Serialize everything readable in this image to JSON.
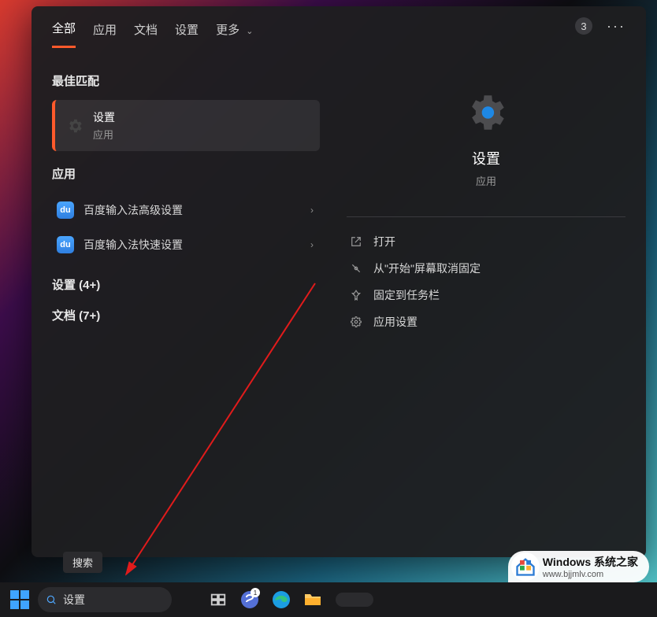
{
  "tabs": {
    "all": "全部",
    "apps": "应用",
    "docs": "文档",
    "settings": "设置",
    "more": "更多"
  },
  "header": {
    "count": "3"
  },
  "left_panel": {
    "best_match_header": "最佳匹配",
    "best_match": {
      "title": "设置",
      "subtitle": "应用"
    },
    "apps_header": "应用",
    "app_items": [
      {
        "icon_text": "du",
        "label": "百度输入法高级设置"
      },
      {
        "icon_text": "du",
        "label": "百度输入法快速设置"
      }
    ],
    "settings_more": "设置 (4+)",
    "docs_more": "文档 (7+)"
  },
  "right_panel": {
    "title": "设置",
    "subtitle": "应用",
    "actions": {
      "open": "打开",
      "unpin_start": "从\"开始\"屏幕取消固定",
      "pin_taskbar": "固定到任务栏",
      "app_settings": "应用设置"
    }
  },
  "tooltip": {
    "search": "搜索"
  },
  "taskbar": {
    "search_value": "设置"
  },
  "watermark": {
    "title": "Windows 系统之家",
    "url": "www.bjjmlv.com"
  }
}
